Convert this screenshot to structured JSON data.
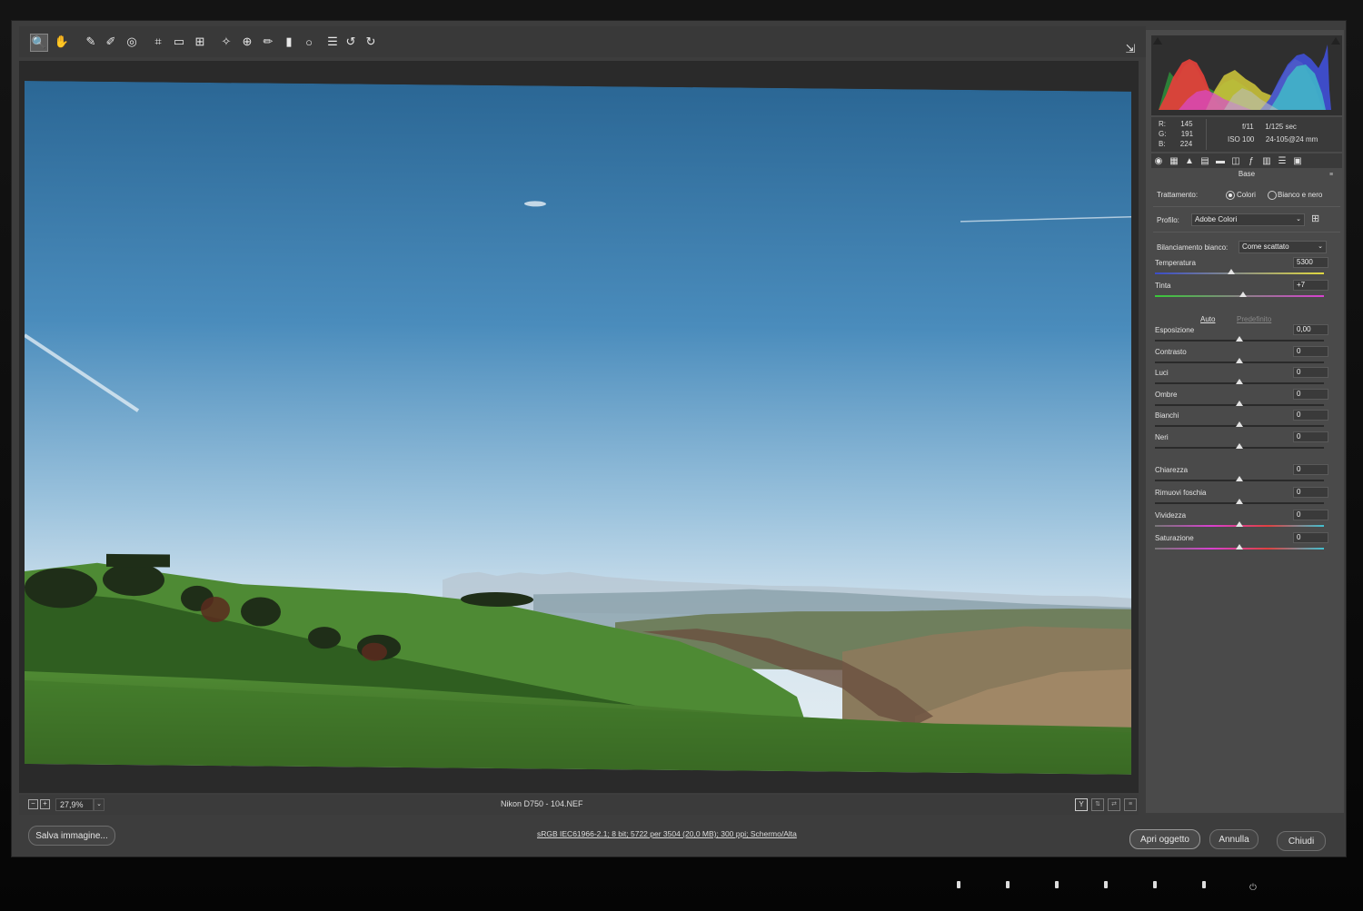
{
  "toolbar": {
    "tools": [
      {
        "icon": "zoom-icon",
        "glyph": "🔍"
      },
      {
        "icon": "hand-icon",
        "glyph": "✋"
      },
      {
        "icon": "white-balance-icon",
        "glyph": "✎"
      },
      {
        "icon": "color-sampler-icon",
        "glyph": "✐"
      },
      {
        "icon": "targeted-adjustment-icon",
        "glyph": "◎"
      },
      {
        "icon": "crop-icon",
        "glyph": "⌗"
      },
      {
        "icon": "straighten-icon",
        "glyph": "▭"
      },
      {
        "icon": "transform-icon",
        "glyph": "⊞"
      },
      {
        "icon": "spot-removal-icon",
        "glyph": "✧"
      },
      {
        "icon": "red-eye-icon",
        "glyph": "⊕"
      },
      {
        "icon": "adjustment-brush-icon",
        "glyph": "✏"
      },
      {
        "icon": "graduated-filter-icon",
        "glyph": "▮"
      },
      {
        "icon": "radial-filter-icon",
        "glyph": "○"
      },
      {
        "icon": "preferences-icon",
        "glyph": "☰"
      },
      {
        "icon": "rotate-left-icon",
        "glyph": "↺"
      },
      {
        "icon": "rotate-right-icon",
        "glyph": "↻"
      }
    ],
    "open_in_icon": "⇲"
  },
  "preview_footer": {
    "zoom": "27,9%",
    "filename": "Nikon D750  -  104.NEF"
  },
  "footer": {
    "save_label": "Salva immagine...",
    "workflow_link": "sRGB IEC61966-2.1; 8 bit; 5722 per 3504 (20,0 MB); 300 ppi; Schermo/Alta",
    "open_label": "Apri oggetto",
    "cancel_label": "Annulla",
    "close_label": "Chiudi"
  },
  "info": {
    "r_label": "R:",
    "r": "145",
    "g_label": "G:",
    "g": "191",
    "b_label": "B:",
    "b": "224",
    "aperture": "f/11",
    "shutter": "1/125 sec",
    "iso": "ISO 100",
    "lens": "24-105@24 mm"
  },
  "panel": {
    "section": "Base",
    "treatment_label": "Trattamento:",
    "treatment_color": "Colori",
    "treatment_bw": "Bianco e nero",
    "profile_label": "Profilo:",
    "profile_value": "Adobe Colori",
    "wb_label": "Bilanciamento bianco:",
    "wb_value": "Come scattato",
    "auto_label": "Auto",
    "default_label": "Predefinito",
    "sliders_top": [
      {
        "label": "Temperatura",
        "value": "5300",
        "pos": 0.45
      },
      {
        "label": "Tinta",
        "value": "+7",
        "pos": 0.52
      }
    ],
    "sliders_tone": [
      {
        "label": "Esposizione",
        "value": "0,00",
        "pos": 0.5
      },
      {
        "label": "Contrasto",
        "value": "0",
        "pos": 0.5
      },
      {
        "label": "Luci",
        "value": "0",
        "pos": 0.5
      },
      {
        "label": "Ombre",
        "value": "0",
        "pos": 0.5
      },
      {
        "label": "Bianchi",
        "value": "0",
        "pos": 0.5
      },
      {
        "label": "Neri",
        "value": "0",
        "pos": 0.5
      }
    ],
    "sliders_presence": [
      {
        "label": "Chiarezza",
        "value": "0",
        "pos": 0.5
      },
      {
        "label": "Rimuovi foschia",
        "value": "0",
        "pos": 0.5
      },
      {
        "label": "Vividezza",
        "value": "0",
        "pos": 0.5
      },
      {
        "label": "Saturazione",
        "value": "0",
        "pos": 0.5
      }
    ]
  },
  "colors": {
    "accent": "#3d3d3d",
    "sky_top": "#2c6a96",
    "sky_bottom": "#dbe9f3",
    "grass": "#3f7a2a"
  }
}
